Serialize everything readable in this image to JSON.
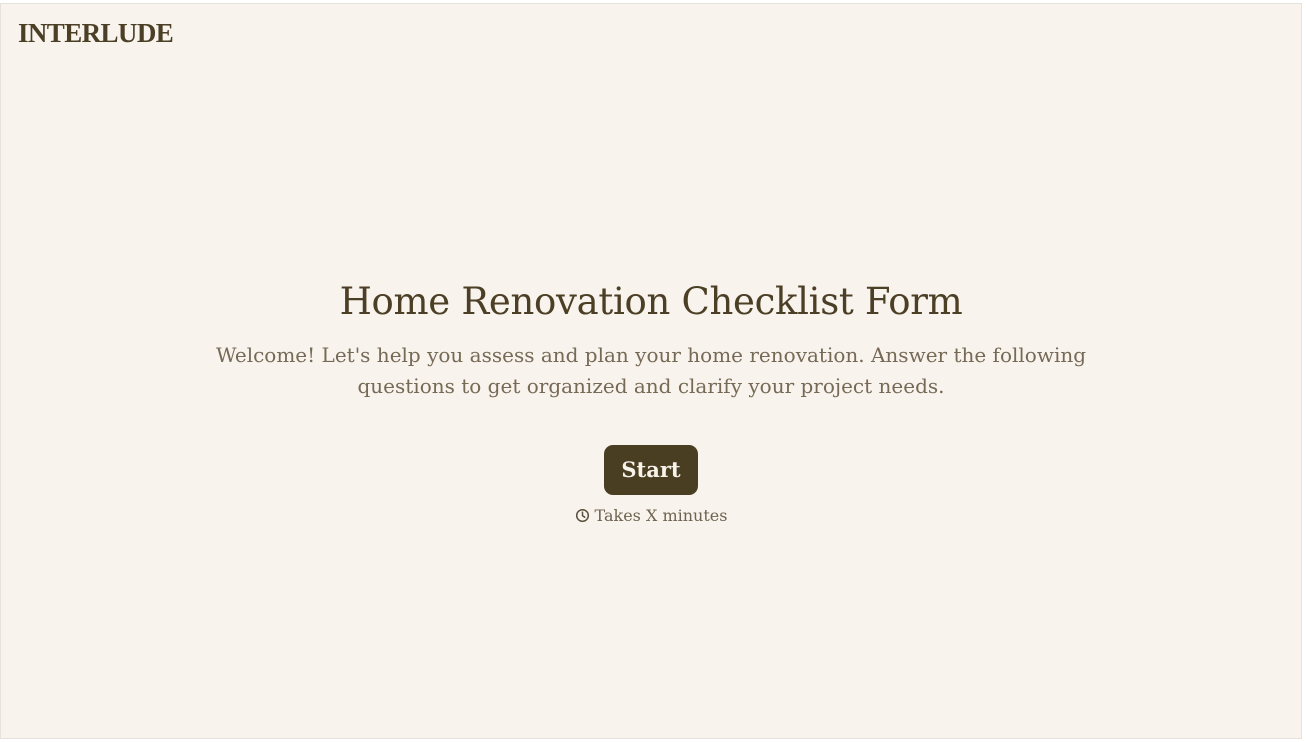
{
  "brand": {
    "logo_text": "INTERLUDE"
  },
  "form": {
    "title": "Home Renovation Checklist Form",
    "description": "Welcome! Let's help you assess and plan your home renovation. Answer the following questions to get organized and clarify your project needs.",
    "start_label": "Start",
    "duration_text": "Takes X minutes"
  },
  "icons": {
    "duration": "clock-icon"
  },
  "colors": {
    "background": "#f8f3ed",
    "brand_text": "#4b3f25",
    "button": "#4a3e22",
    "button_text": "#f7f2ea",
    "muted_text": "#766a56"
  }
}
